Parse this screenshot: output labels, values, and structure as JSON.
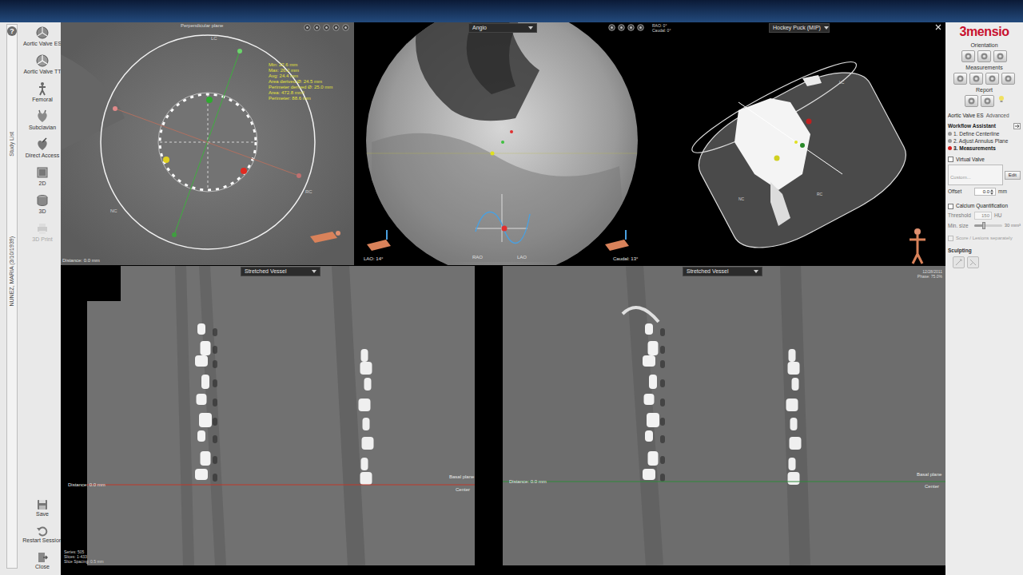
{
  "app": {
    "logo": "3mensio",
    "study_list": "Study List",
    "patient": "NUNEZ, MARIA (3/10/1939)"
  },
  "toolbar": {
    "help": "?",
    "items": [
      {
        "label": "Aortic Valve ES",
        "selected": true,
        "disabled": false
      },
      {
        "label": "Aortic Valve TT",
        "selected": false,
        "disabled": false
      },
      {
        "label": "Femoral",
        "selected": false,
        "disabled": false
      },
      {
        "label": "Subclavian",
        "selected": false,
        "disabled": false
      },
      {
        "label": "Direct Access",
        "selected": false,
        "disabled": false
      },
      {
        "label": "2D",
        "selected": false,
        "disabled": false
      },
      {
        "label": "3D",
        "selected": false,
        "disabled": false
      },
      {
        "label": "3D Print",
        "selected": false,
        "disabled": true
      }
    ],
    "actions": [
      {
        "label": "Save"
      },
      {
        "label": "Restart Session"
      },
      {
        "label": "Close"
      }
    ]
  },
  "viewports": {
    "perpendicular": {
      "title": "Perpendicular plane",
      "measurements": [
        "Min: 22.6 mm",
        "Max: 26.2 mm",
        "Avg: 24.4 mm",
        "Area derived Ø: 24.5 mm",
        "Perimeter derived Ø: 25.0 mm",
        "Area: 472.8 mm²",
        "Perimeter: 88.6 mm"
      ],
      "cusps": [
        "LC",
        "RC",
        "NC"
      ],
      "distance": "Distance: 0.0 mm"
    },
    "angio": {
      "mode": "Angio",
      "lao": "LAO: 14°",
      "caudal": "Caudal: 13°",
      "axis": [
        "RAO",
        "LAO"
      ]
    },
    "hockey_puck": {
      "mode": "Hockey Puck (MIP)",
      "rao": "RAO: 0°",
      "caudal": "Caudal: 0°",
      "cusps": [
        "LC",
        "RC",
        "NC"
      ]
    },
    "stretched_left": {
      "mode": "Stretched Vessel",
      "distance": "Distance: 0.0 mm",
      "plane": "Basal plane",
      "center": "Center"
    },
    "stretched_right": {
      "mode": "Stretched Vessel",
      "distance": "Distance: 0.0 mm",
      "plane": "Basal plane",
      "center": "Center",
      "info": [
        "12/28/2011",
        "Phase: 75.0%"
      ]
    }
  },
  "series_info": [
    "Series: 505",
    "Slices: 1-433",
    "Slice Spacing: 0.5 mm"
  ],
  "right_panel": {
    "sections": [
      {
        "title": "Orientation"
      },
      {
        "title": "Measurements"
      },
      {
        "title": "Report"
      }
    ],
    "protocol": "Aortic Valve ES",
    "advanced": "Advanced",
    "workflow": {
      "title": "Workflow Assistant",
      "steps": [
        {
          "label": "1. Define Centerline",
          "selected": false
        },
        {
          "label": "2. Adjust Annulus Plane",
          "selected": false
        },
        {
          "label": "3. Measurements",
          "selected": true
        }
      ]
    },
    "virtual_valve": {
      "label": "Virtual Valve",
      "checked": false,
      "field": "Custom...",
      "edit": "Edit",
      "offset_label": "Offset",
      "offset": "0.0",
      "unit": "mm"
    },
    "calcium": {
      "label": "Calcium Quantification",
      "checked": false,
      "threshold_label": "Threshold",
      "threshold": "150",
      "threshold_unit": "HU",
      "min_size_label": "Min. size",
      "min_size_level": 0.35,
      "min_size": "30 mm³",
      "score": {
        "label": "Score / Lesions separately",
        "checked": false,
        "disabled": true
      }
    },
    "sculpting": "Sculpting"
  }
}
